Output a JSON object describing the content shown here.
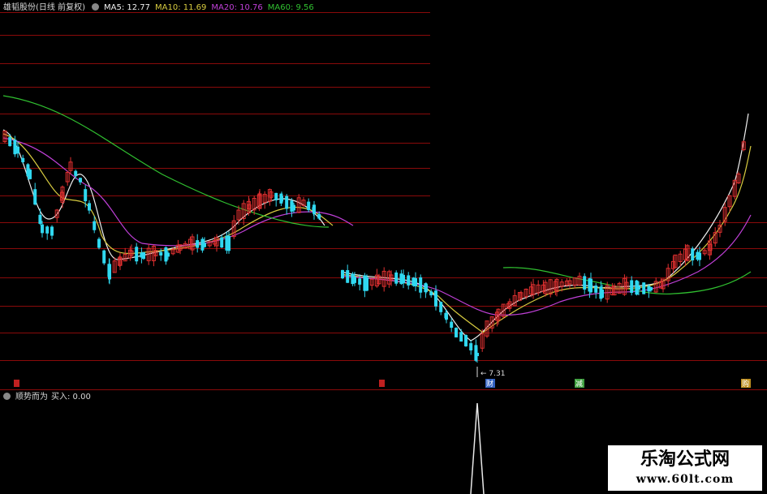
{
  "header": {
    "stock_name": "雄韬股份(日线 前复权)",
    "ma5_label": "MA5: 12.77",
    "ma10_label": "MA10: 11.69",
    "ma20_label": "MA20: 10.76",
    "ma60_label": "MA60: 9.56"
  },
  "indicator_header": {
    "name": "顺势而为",
    "buy_label": "买入: 0.00"
  },
  "annotations": {
    "low_price": "7.31",
    "marker_cai": "财",
    "marker_jian": "减",
    "marker_gou": "购"
  },
  "watermark": {
    "title": "乐淘公式网",
    "url": "www.60lt.com"
  },
  "colors": {
    "background": "#000000",
    "grid": "#8a0a0a",
    "up": "#e03030",
    "down": "#30d8f0",
    "ma5": "#f0f0f0",
    "ma10": "#d8cc40",
    "ma20": "#c040d8",
    "ma60": "#30c030",
    "marker": "#5080e0"
  }
}
